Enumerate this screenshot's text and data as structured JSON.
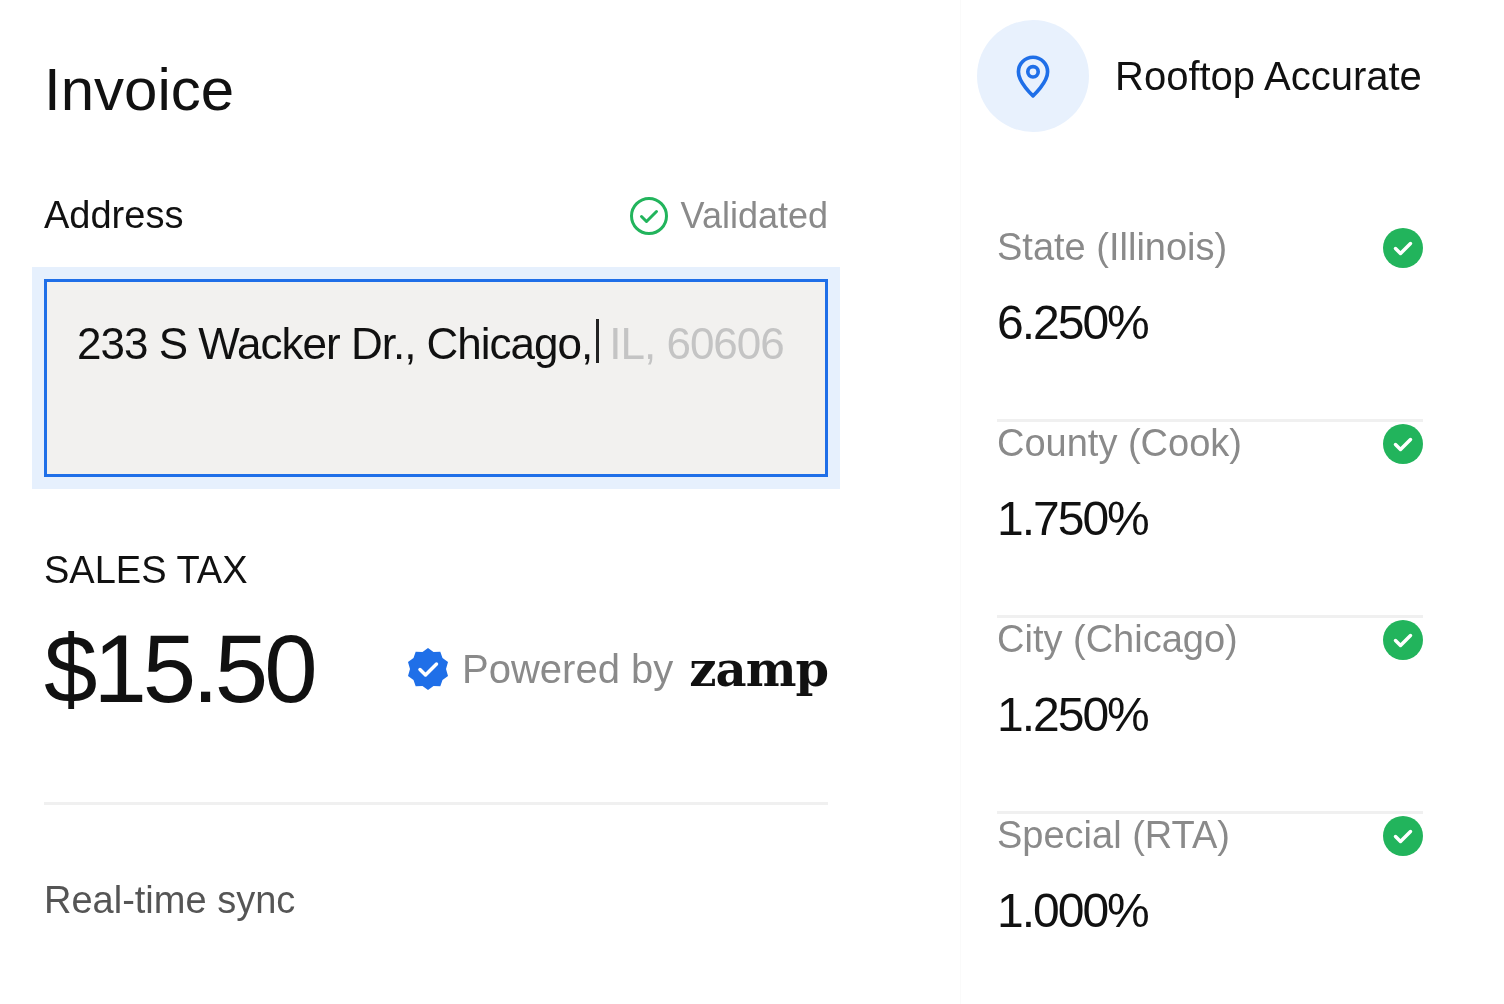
{
  "title": "Invoice",
  "address": {
    "label": "Address",
    "status": {
      "text": "Validated",
      "validated": true
    },
    "value": "233 S Wacker Dr., Chicago,",
    "suggestion": "IL, 60606",
    "focused": true
  },
  "sales_tax": {
    "label": "SALES TAX",
    "amount": "$15.50",
    "powered_by": "Powered by",
    "brand": "zamp"
  },
  "sync": {
    "label": "Real-time sync"
  },
  "accuracy": {
    "label": "Rooftop Accurate"
  },
  "rates": [
    {
      "name": "State (Illinois)",
      "rate": "6.250%",
      "verified": true
    },
    {
      "name": "County (Cook)",
      "rate": "1.750%",
      "verified": true
    },
    {
      "name": "City (Chicago)",
      "rate": "1.250%",
      "verified": true
    },
    {
      "name": "Special (RTA)",
      "rate": "1.000%",
      "verified": true
    }
  ]
}
